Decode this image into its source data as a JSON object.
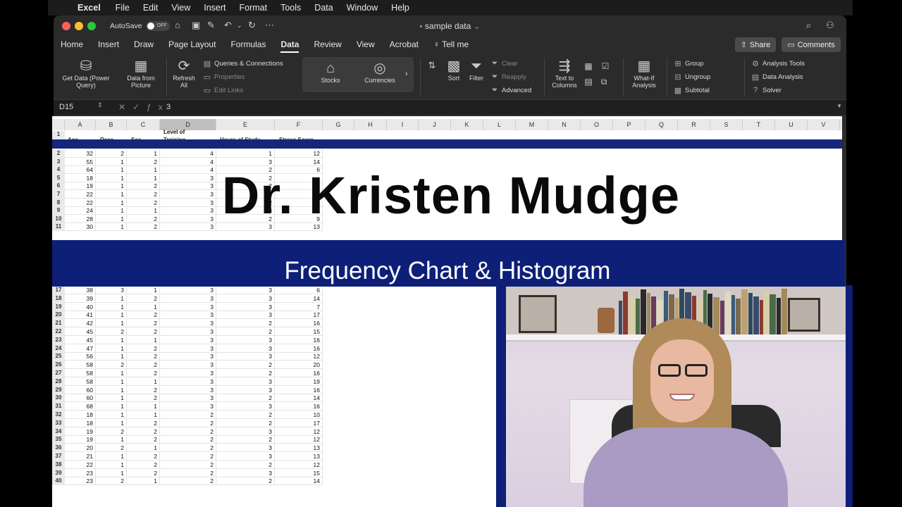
{
  "menubar": {
    "app": "Excel",
    "items": [
      "File",
      "Edit",
      "View",
      "Insert",
      "Format",
      "Tools",
      "Data",
      "Window",
      "Help"
    ]
  },
  "titlebar": {
    "autosave_label": "AutoSave",
    "toggle_state": "OFF",
    "doc_title": "sample data"
  },
  "tabs": [
    "Home",
    "Insert",
    "Draw",
    "Page Layout",
    "Formulas",
    "Data",
    "Review",
    "View",
    "Acrobat"
  ],
  "active_tab": "Data",
  "tell_me": "Tell me",
  "share_label": "Share",
  "comments_label": "Comments",
  "ribbon": {
    "get_data": "Get Data (Power Query)",
    "data_from_picture": "Data from Picture",
    "refresh_all": "Refresh All",
    "queries": "Queries & Connections",
    "properties": "Properties",
    "edit_links": "Edit Links",
    "stocks": "Stocks",
    "currencies": "Currencies",
    "sort": "Sort",
    "filter": "Filter",
    "clear": "Clear",
    "reapply": "Reapply",
    "advanced": "Advanced",
    "text_to_columns": "Text to Columns",
    "what_if": "What-If Analysis",
    "group": "Group",
    "ungroup": "Ungroup",
    "subtotal": "Subtotal",
    "analysis_tools": "Analysis Tools",
    "data_analysis": "Data Analysis",
    "solver": "Solver"
  },
  "formula_bar": {
    "name_box": "D15",
    "value": "3"
  },
  "columns": [
    "A",
    "B",
    "C",
    "D",
    "E",
    "F",
    "G",
    "H",
    "I",
    "J",
    "K",
    "L",
    "M",
    "N",
    "O",
    "P",
    "Q",
    "R",
    "S",
    "T",
    "U",
    "V"
  ],
  "selected_column": "D",
  "headers": {
    "d": "Level of",
    "d2": "Training",
    "a": "Age",
    "b": "Race",
    "c": "Sex",
    "e": "Hours of Study",
    "f": "Stress Score"
  },
  "rows_top": [
    {
      "n": "2",
      "v": [
        "32",
        "2",
        "1",
        "4",
        "1",
        "12"
      ]
    },
    {
      "n": "3",
      "v": [
        "55",
        "1",
        "2",
        "4",
        "3",
        "14"
      ]
    },
    {
      "n": "4",
      "v": [
        "64",
        "1",
        "1",
        "4",
        "2",
        "6"
      ]
    },
    {
      "n": "5",
      "v": [
        "18",
        "1",
        "1",
        "3",
        "2",
        ""
      ]
    },
    {
      "n": "6",
      "v": [
        "19",
        "1",
        "2",
        "3",
        "2",
        "13"
      ]
    },
    {
      "n": "7",
      "v": [
        "22",
        "1",
        "2",
        "3",
        "2",
        "11"
      ]
    },
    {
      "n": "8",
      "v": [
        "22",
        "1",
        "2",
        "3",
        "2",
        "8"
      ]
    },
    {
      "n": "9",
      "v": [
        "24",
        "1",
        "1",
        "3",
        "3",
        "12"
      ]
    },
    {
      "n": "10",
      "v": [
        "28",
        "1",
        "2",
        "3",
        "2",
        "9"
      ]
    },
    {
      "n": "11",
      "v": [
        "30",
        "1",
        "2",
        "3",
        "3",
        "13"
      ]
    }
  ],
  "rows_bottom": [
    {
      "n": "17",
      "v": [
        "38",
        "3",
        "1",
        "3",
        "3",
        "6"
      ]
    },
    {
      "n": "18",
      "v": [
        "39",
        "1",
        "2",
        "3",
        "3",
        "14"
      ]
    },
    {
      "n": "19",
      "v": [
        "40",
        "1",
        "1",
        "3",
        "3",
        "7"
      ]
    },
    {
      "n": "20",
      "v": [
        "41",
        "1",
        "2",
        "3",
        "3",
        "17"
      ]
    },
    {
      "n": "21",
      "v": [
        "42",
        "1",
        "2",
        "3",
        "2",
        "16"
      ]
    },
    {
      "n": "22",
      "v": [
        "45",
        "2",
        "2",
        "3",
        "2",
        "15"
      ]
    },
    {
      "n": "23",
      "v": [
        "45",
        "1",
        "1",
        "3",
        "3",
        "16"
      ]
    },
    {
      "n": "24",
      "v": [
        "47",
        "1",
        "2",
        "3",
        "3",
        "16"
      ]
    },
    {
      "n": "25",
      "v": [
        "56",
        "1",
        "2",
        "3",
        "3",
        "12"
      ]
    },
    {
      "n": "26",
      "v": [
        "58",
        "2",
        "2",
        "3",
        "2",
        "20"
      ]
    },
    {
      "n": "27",
      "v": [
        "58",
        "1",
        "2",
        "3",
        "2",
        "16"
      ]
    },
    {
      "n": "28",
      "v": [
        "58",
        "1",
        "1",
        "3",
        "3",
        "19"
      ]
    },
    {
      "n": "29",
      "v": [
        "60",
        "1",
        "2",
        "3",
        "3",
        "16"
      ]
    },
    {
      "n": "30",
      "v": [
        "60",
        "1",
        "2",
        "3",
        "2",
        "14"
      ]
    },
    {
      "n": "31",
      "v": [
        "68",
        "1",
        "1",
        "3",
        "3",
        "16"
      ]
    },
    {
      "n": "32",
      "v": [
        "18",
        "1",
        "1",
        "2",
        "2",
        "10"
      ]
    },
    {
      "n": "33",
      "v": [
        "18",
        "1",
        "2",
        "2",
        "2",
        "17"
      ]
    },
    {
      "n": "34",
      "v": [
        "19",
        "2",
        "2",
        "2",
        "3",
        "12"
      ]
    },
    {
      "n": "35",
      "v": [
        "19",
        "1",
        "2",
        "2",
        "2",
        "12"
      ]
    },
    {
      "n": "36",
      "v": [
        "20",
        "2",
        "1",
        "2",
        "3",
        "13"
      ]
    },
    {
      "n": "37",
      "v": [
        "21",
        "1",
        "2",
        "2",
        "3",
        "13"
      ]
    },
    {
      "n": "38",
      "v": [
        "22",
        "1",
        "2",
        "2",
        "2",
        "12"
      ]
    },
    {
      "n": "39",
      "v": [
        "23",
        "1",
        "2",
        "2",
        "3",
        "15"
      ]
    },
    {
      "n": "40",
      "v": [
        "23",
        "2",
        "1",
        "2",
        "2",
        "14"
      ]
    }
  ],
  "overlay": {
    "name": "Dr. Kristen Mudge",
    "subtitle": "Frequency Chart & Histogram"
  },
  "colors": {
    "banner": "#0e1f78",
    "excel_chrome": "#2b2b2b"
  }
}
